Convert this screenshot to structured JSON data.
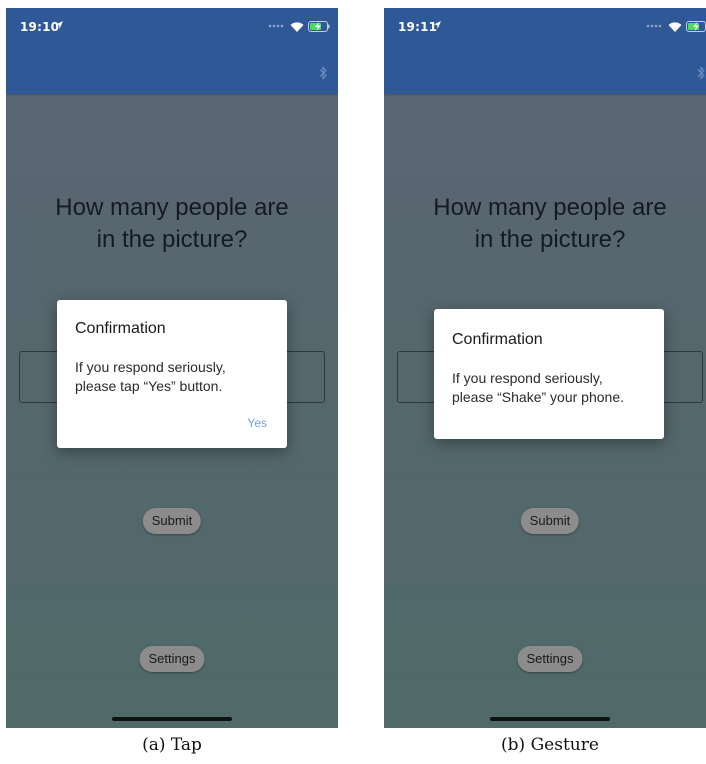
{
  "screens": [
    {
      "status_time": "19:10",
      "question_line1": "How many people are",
      "question_line2": "in the picture?",
      "submit_label": "Submit",
      "settings_label": "Settings",
      "dialog": {
        "title": "Confirmation",
        "message_line1": "If you respond seriously,",
        "message_line2": "please tap “Yes” button.",
        "yes_label": "Yes"
      },
      "caption": "(a) Tap"
    },
    {
      "status_time": "19:11",
      "question_line1": "How many people are",
      "question_line2": "in the picture?",
      "submit_label": "Submit",
      "settings_label": "Settings",
      "dialog": {
        "title": "Confirmation",
        "message_line1": "If you respond seriously,",
        "message_line2": "please “Shake” your phone."
      },
      "caption": "(b) Gesture"
    }
  ],
  "icons": {
    "location": "location-arrow-icon",
    "signal": "signal-dots-icon",
    "wifi": "wifi-icon",
    "battery": "battery-charging-icon",
    "bluetooth": "bluetooth-icon"
  },
  "colors": {
    "navbar": "#2f5896",
    "dialog_action": "#6ea6dc",
    "background_top": "#5d6776",
    "background_bottom": "#4f6a68"
  }
}
